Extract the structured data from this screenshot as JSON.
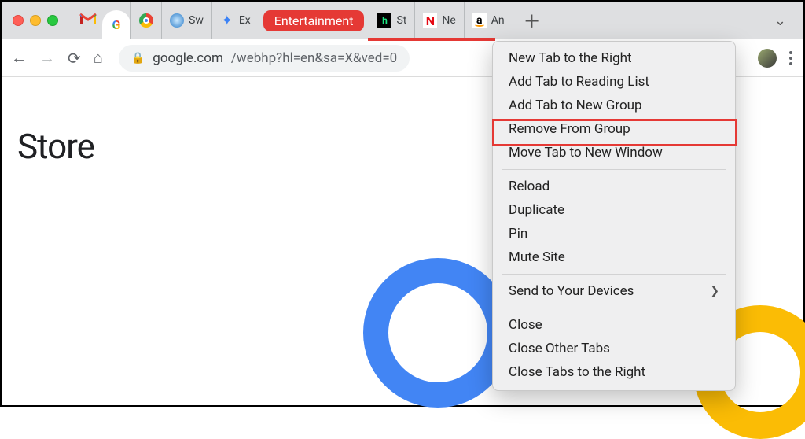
{
  "tabs": {
    "chrome_label": "Sw",
    "ext_label": "Ex",
    "group_label": "Entertainment",
    "hulu_label": "St",
    "netflix_label": "Ne",
    "amazon_label": "An"
  },
  "toolbar": {
    "url_host": "google.com",
    "url_path": "/webhp?hl=en&sa=X&ved=0"
  },
  "page": {
    "store_text": "Store"
  },
  "context_menu": {
    "items_group1": [
      "New Tab to the Right",
      "Add Tab to Reading List",
      "Add Tab to New Group",
      "Remove From Group",
      "Move Tab to New Window"
    ],
    "items_group2": [
      "Reload",
      "Duplicate",
      "Pin",
      "Mute Site"
    ],
    "items_group3": [
      "Send to Your Devices"
    ],
    "items_group4": [
      "Close",
      "Close Other Tabs",
      "Close Tabs to the Right"
    ]
  }
}
